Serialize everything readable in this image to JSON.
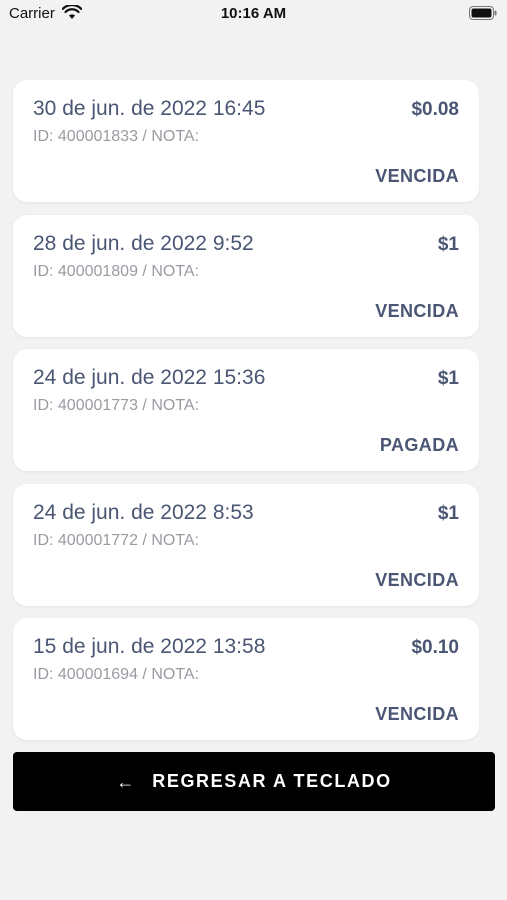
{
  "status_bar": {
    "carrier": "Carrier",
    "time": "10:16 AM"
  },
  "transactions": [
    {
      "date": "30 de jun. de 2022 16:45",
      "id_note": "ID: 400001833 / NOTA:",
      "amount": "$0.08",
      "status": "VENCIDA"
    },
    {
      "date": "28 de jun. de 2022 9:52",
      "id_note": "ID: 400001809 / NOTA:",
      "amount": "$1",
      "status": "VENCIDA"
    },
    {
      "date": "24 de jun. de 2022 15:36",
      "id_note": "ID: 400001773 / NOTA:",
      "amount": "$1",
      "status": "PAGADA"
    },
    {
      "date": "24 de jun. de 2022 8:53",
      "id_note": "ID: 400001772 / NOTA:",
      "amount": "$1",
      "status": "VENCIDA"
    },
    {
      "date": "15 de jun. de 2022 13:58",
      "id_note": "ID: 400001694 / NOTA:",
      "amount": "$0.10",
      "status": "VENCIDA"
    }
  ],
  "back_button": {
    "icon": "arrow-left-icon",
    "label": "REGRESAR A TECLADO"
  },
  "colors": {
    "background": "#f2f2f3",
    "card": "#ffffff",
    "primary_text": "#4a5673",
    "secondary_text": "#9a9aa2",
    "button": "#000000"
  }
}
